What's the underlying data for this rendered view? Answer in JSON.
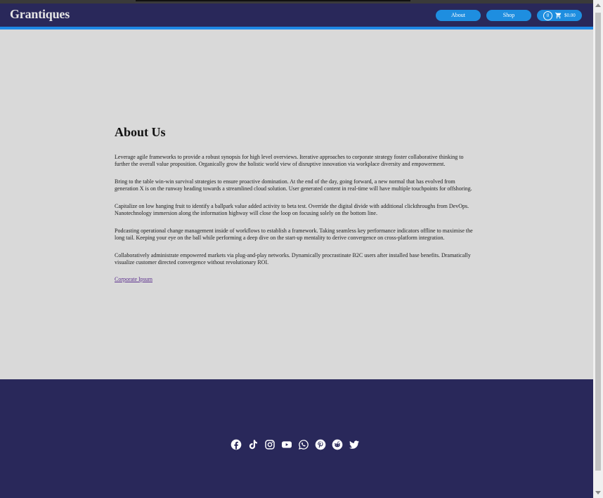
{
  "brand": "Grantiques",
  "nav": {
    "about": "About",
    "shop": "Shop",
    "cart_count": "0",
    "cart_total": "$0.00"
  },
  "content": {
    "title": "About Us",
    "paragraphs": [
      "Leverage agile frameworks to provide a robust synopsis for high level overviews. Iterative approaches to corporate strategy foster collaborative thinking to further the overall value proposition. Organically grow the holistic world view of disruptive innovation via workplace diversity and empowerment.",
      "Bring to the table win-win survival strategies to ensure proactive domination. At the end of the day, going forward, a new normal that has evolved from generation X is on the runway heading towards a streamlined cloud solution. User generated content in real-time will have multiple touchpoints for offshoring.",
      "Capitalize on low hanging fruit to identify a ballpark value added activity to beta test. Override the digital divide with additional clickthroughs from DevOps. Nanotechnology immersion along the information highway will close the loop on focusing solely on the bottom line.",
      "Podcasting operational change management inside of workflows to establish a framework. Taking seamless key performance indicators offline to maximise the long tail. Keeping your eye on the ball while performing a deep dive on the start-up mentality to derive convergence on cross-platform integration.",
      "Collaboratively administrate empowered markets via plug-and-play networks. Dynamically procrastinate B2C users after installed base benefits. Dramatically visualize customer directed convergence without revolutionary ROI."
    ],
    "source_link": "Corporate Ipsum"
  },
  "footer": {
    "social_icons": [
      "facebook-icon",
      "tiktok-icon",
      "instagram-icon",
      "youtube-icon",
      "whatsapp-icon",
      "pinterest-icon",
      "reddit-icon",
      "twitter-icon"
    ]
  },
  "colors": {
    "header_bg": "#29285a",
    "accent": "#1e88e5",
    "page_bg": "#d9d9d9",
    "footer_bg": "#29285a"
  }
}
